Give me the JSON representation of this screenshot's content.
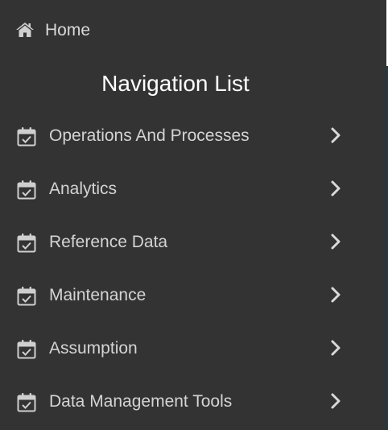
{
  "home": {
    "icon": "home-icon",
    "label": "Home"
  },
  "navigation": {
    "title": "Navigation List",
    "item_icon": "calendar-check-icon",
    "expand_icon": "chevron-right-icon",
    "items": [
      {
        "label": "Operations And Processes"
      },
      {
        "label": "Analytics"
      },
      {
        "label": "Reference Data"
      },
      {
        "label": "Maintenance"
      },
      {
        "label": "Assumption"
      },
      {
        "label": "Data Management Tools"
      }
    ]
  },
  "colors": {
    "panel_background": "#333333",
    "text_primary": "#ffffff",
    "text_secondary": "#d4d4d4",
    "icon": "#cfcfcf"
  }
}
